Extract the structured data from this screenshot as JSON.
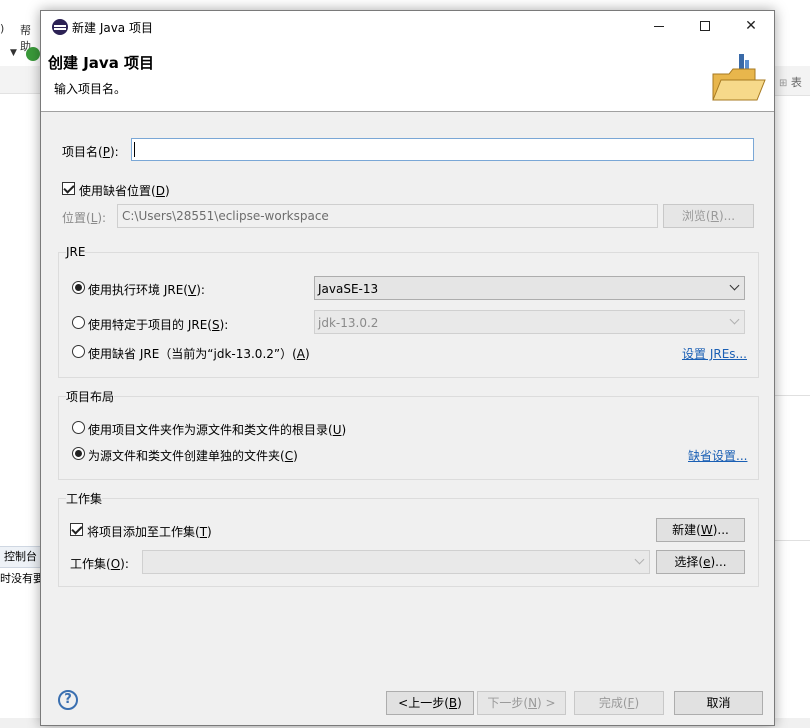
{
  "background": {
    "menu_items": [
      ")",
      "帮助"
    ],
    "right_panel_label": "表",
    "console_tab": "控制台",
    "console_text": "时没有要"
  },
  "dialog": {
    "window_title": "新建 Java 项目",
    "banner_title": "创建 Java 项目",
    "banner_message": "输入项目名。",
    "project_name": {
      "label_prefix": "项目名(",
      "mnemonic": "P",
      "label_suffix": "):",
      "value": ""
    },
    "use_default_location": {
      "label_prefix": "使用缺省位置(",
      "mnemonic": "D",
      "label_suffix": ")",
      "checked": true
    },
    "location": {
      "label_prefix": "位置(",
      "mnemonic": "L",
      "label_suffix": "):",
      "value": "C:\\Users\\28551\\eclipse-workspace",
      "browse_prefix": "浏览(",
      "browse_mnemonic": "R",
      "browse_suffix": ")..."
    },
    "jre_group": {
      "title": "JRE",
      "option_exec_env": {
        "label_prefix": "使用执行环境 JRE(",
        "mnemonic": "V",
        "label_suffix": "):",
        "selected": true,
        "combo_value": "JavaSE-13"
      },
      "option_project_specific": {
        "label_prefix": "使用特定于项目的 JRE(",
        "mnemonic": "S",
        "label_suffix": "):",
        "selected": false,
        "combo_value": "jdk-13.0.2"
      },
      "option_default": {
        "label_prefix": "使用缺省 JRE（当前为“jdk-13.0.2”）(",
        "mnemonic": "A",
        "label_suffix": ")",
        "selected": false
      },
      "configure_link": "设置 JREs..."
    },
    "layout_group": {
      "title": "项目布局",
      "option_single": {
        "label_prefix": "使用项目文件夹作为源文件和类文件的根目录(",
        "mnemonic": "U",
        "label_suffix": ")",
        "selected": false
      },
      "option_separate": {
        "label_prefix": "为源文件和类文件创建单独的文件夹(",
        "mnemonic": "C",
        "label_suffix": ")",
        "selected": true
      },
      "defaults_link": "缺省设置..."
    },
    "working_set_group": {
      "title": "工作集",
      "add_checkbox": {
        "label_prefix": "将项目添加至工作集(",
        "mnemonic": "T",
        "label_suffix": ")",
        "checked": true
      },
      "new_button": {
        "prefix": "新建(",
        "mnemonic": "W",
        "suffix": ")..."
      },
      "working_sets_label": {
        "prefix": "工作集(",
        "mnemonic": "O",
        "suffix": "):"
      },
      "working_sets_value": "",
      "select_button": {
        "prefix": "选择(",
        "mnemonic": "e",
        "suffix": ")..."
      }
    },
    "footer": {
      "back": {
        "prefix": "<上一步(",
        "mnemonic": "B",
        "suffix": ")"
      },
      "next": {
        "prefix": "下一步(",
        "mnemonic": "N",
        "suffix": ") >"
      },
      "finish": {
        "prefix": "完成(",
        "mnemonic": "F",
        "suffix": ")"
      },
      "cancel": "取消"
    }
  },
  "colors": {
    "link": "#1a5fb4",
    "dialog_bg": "#f0f0f0",
    "focus_border": "#7aa7d6"
  }
}
